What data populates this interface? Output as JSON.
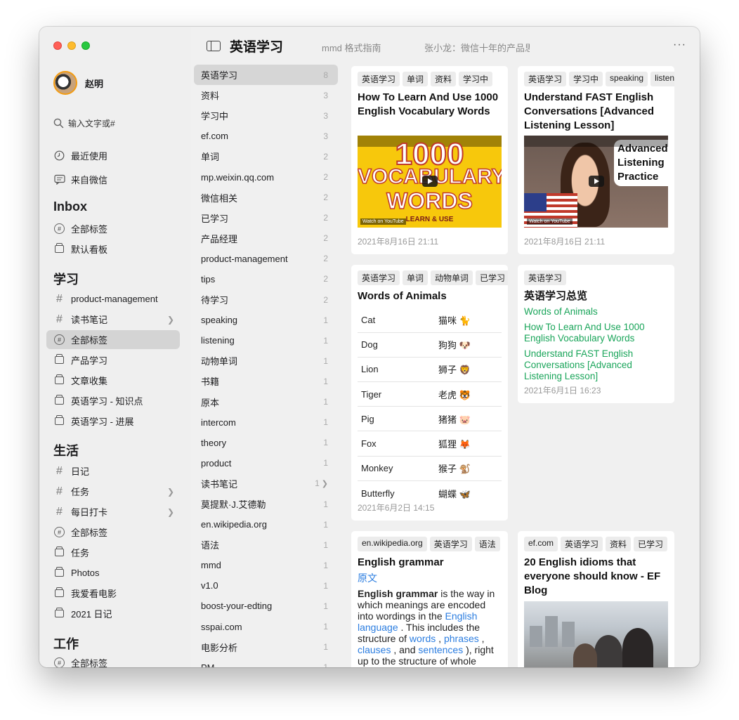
{
  "window": {
    "title": "英语学习",
    "tabs": [
      "mmd 格式指南",
      "张小龙：微信十年的产品思考"
    ],
    "more_label": "···"
  },
  "sidebar": {
    "user": "赵明",
    "search_placeholder": "输入文字或#",
    "quick": [
      {
        "icon": "clock-icon",
        "label": "最近使用"
      },
      {
        "icon": "chat-icon",
        "label": "来自微信"
      }
    ],
    "sections": [
      {
        "title": "Inbox",
        "items": [
          {
            "icon": "circle-hash-icon",
            "label": "全部标签"
          },
          {
            "icon": "box-icon",
            "label": "默认看板"
          }
        ]
      },
      {
        "title": "学习",
        "items": [
          {
            "icon": "hash-icon",
            "label": "product-management"
          },
          {
            "icon": "hash-icon",
            "label": "读书笔记",
            "chevron": true
          },
          {
            "icon": "circle-hash-icon",
            "label": "全部标签",
            "active": true
          },
          {
            "icon": "box-icon",
            "label": "产品学习"
          },
          {
            "icon": "box-icon",
            "label": "文章收集"
          },
          {
            "icon": "box-icon",
            "label": "英语学习 - 知识点"
          },
          {
            "icon": "box-icon",
            "label": "英语学习 - 进展"
          }
        ]
      },
      {
        "title": "生活",
        "items": [
          {
            "icon": "hash-icon",
            "label": "日记"
          },
          {
            "icon": "hash-icon",
            "label": "任务",
            "chevron": true
          },
          {
            "icon": "hash-icon",
            "label": "每日打卡",
            "chevron": true
          },
          {
            "icon": "circle-hash-icon",
            "label": "全部标签"
          },
          {
            "icon": "box-icon",
            "label": "任务"
          },
          {
            "icon": "box-icon",
            "label": "Photos"
          },
          {
            "icon": "box-icon",
            "label": "我爱看电影"
          },
          {
            "icon": "box-icon",
            "label": "2021 日记"
          }
        ]
      },
      {
        "title": "工作",
        "items": [
          {
            "icon": "circle-hash-icon",
            "label": "全部标签"
          }
        ]
      }
    ]
  },
  "tags": [
    {
      "label": "英语学习",
      "count": "8",
      "active": true
    },
    {
      "label": "资料",
      "count": "3"
    },
    {
      "label": "学习中",
      "count": "3"
    },
    {
      "label": "ef.com",
      "count": "3"
    },
    {
      "label": "单词",
      "count": "2"
    },
    {
      "label": "mp.weixin.qq.com",
      "count": "2"
    },
    {
      "label": "微信相关",
      "count": "2"
    },
    {
      "label": "已学习",
      "count": "2"
    },
    {
      "label": "产品经理",
      "count": "2"
    },
    {
      "label": "product-management",
      "count": "2"
    },
    {
      "label": "tips",
      "count": "2"
    },
    {
      "label": "待学习",
      "count": "2"
    },
    {
      "label": "speaking",
      "count": "1"
    },
    {
      "label": "listening",
      "count": "1"
    },
    {
      "label": "动物单词",
      "count": "1"
    },
    {
      "label": "书籍",
      "count": "1"
    },
    {
      "label": "原本",
      "count": "1"
    },
    {
      "label": "intercom",
      "count": "1"
    },
    {
      "label": "theory",
      "count": "1"
    },
    {
      "label": "product",
      "count": "1"
    },
    {
      "label": "读书笔记",
      "count": "1",
      "chevron": true
    },
    {
      "label": "莫提默·J.艾德勒",
      "count": "1"
    },
    {
      "label": "en.wikipedia.org",
      "count": "1"
    },
    {
      "label": "语法",
      "count": "1"
    },
    {
      "label": "mmd",
      "count": "1"
    },
    {
      "label": "v1.0",
      "count": "1"
    },
    {
      "label": "boost-your-edting",
      "count": "1"
    },
    {
      "label": "sspai.com",
      "count": "1"
    },
    {
      "label": "电影分析",
      "count": "1"
    },
    {
      "label": "PM",
      "count": "1"
    }
  ],
  "cards": {
    "vocab": {
      "chips": [
        "英语学习",
        "单词",
        "资料",
        "学习中"
      ],
      "title": "How To Learn And Use 1000 English Vocabulary Words",
      "thumb": {
        "line1": "1000",
        "line2": "VOCABULARY",
        "line3": "WORDS",
        "line4": "LEARN & USE",
        "watch": "Watch on YouTube"
      },
      "date": "2021年8月16日 21:11"
    },
    "fast": {
      "chips": [
        "英语学习",
        "学习中",
        "speaking",
        "listening"
      ],
      "title": "Understand FAST English Conversations [Advanced Listening Lesson]",
      "thumb": {
        "bubble1": "Advanced",
        "bubble2": "Listening",
        "bubble3": "Practice",
        "watch": "Watch on YouTube"
      },
      "date": "2021年8月16日 21:11"
    },
    "animals": {
      "chips": [
        "英语学习",
        "单词",
        "动物单词",
        "已学习"
      ],
      "title": "Words of Animals",
      "rows": [
        {
          "en": "Cat",
          "cn": "猫咪 🐈"
        },
        {
          "en": "Dog",
          "cn": "狗狗 🐶"
        },
        {
          "en": "Lion",
          "cn": "狮子 🦁"
        },
        {
          "en": "Tiger",
          "cn": "老虎 🐯"
        },
        {
          "en": "Pig",
          "cn": "猪猪 🐷"
        },
        {
          "en": "Fox",
          "cn": "狐狸 🦊"
        },
        {
          "en": "Monkey",
          "cn": "猴子 🐒"
        },
        {
          "en": "Butterfly",
          "cn": "蝴蝶 🦋"
        }
      ],
      "date": "2021年6月2日 14:15"
    },
    "overview": {
      "chips": [
        "英语学习"
      ],
      "title": "英语学习总览",
      "links": [
        "Words of Animals",
        "How To Learn And Use 1000 English Vocabulary Words",
        "Understand FAST English Conversations [Advanced Listening Lesson]"
      ],
      "date": "2021年6月1日 16:23"
    },
    "grammar": {
      "chips": [
        "en.wikipedia.org",
        "英语学习",
        "语法"
      ],
      "title": "English grammar",
      "source_link": "原文",
      "body": {
        "bold": "English grammar",
        "t1": " is the way in which meanings are encoded into wordings in the ",
        "l1": "English language",
        "t2": " . This includes the structure of ",
        "l2": "words",
        "t3": " , ",
        "l3": "phrases",
        "t4": " , ",
        "l4": "clauses",
        "t5": " , and ",
        "l5": "sentences",
        "t6": " ), right up to the structure of whole"
      }
    },
    "idioms": {
      "chips": [
        "ef.com",
        "英语学习",
        "资料",
        "已学习"
      ],
      "title": "20 English idioms that everyone should know - EF Blog"
    }
  },
  "colors": {
    "green_link": "#1aa55a",
    "blue_link": "#2b7de0",
    "active_row": "#d4d4d4"
  }
}
